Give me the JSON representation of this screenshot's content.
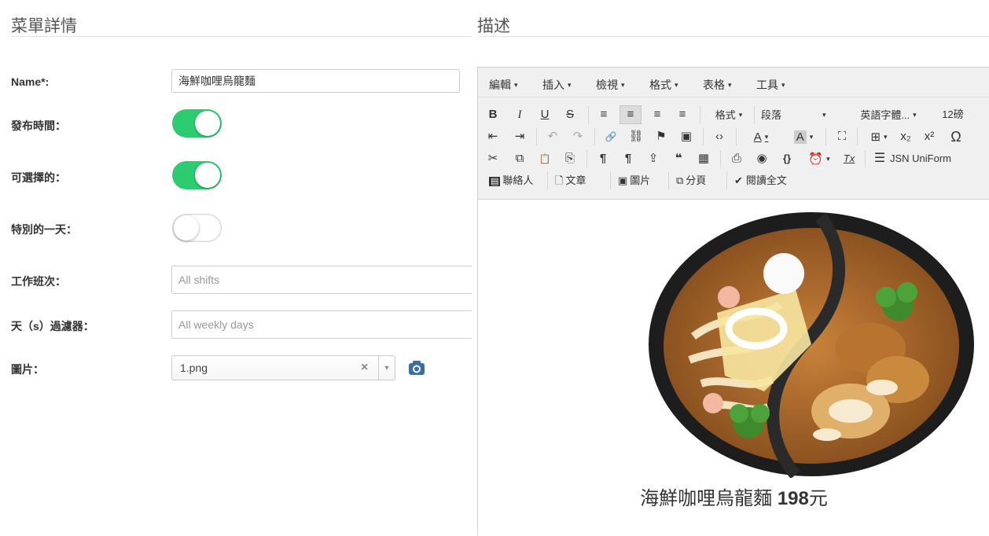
{
  "left_panel": {
    "title": "菜單詳情",
    "name_label": "Name*:",
    "name_value": "海鮮咖哩烏龍麵",
    "publish_label": "發布時間：",
    "publish_on": true,
    "selectable_label": "可選擇的：",
    "selectable_on": true,
    "special_day_label": "特別的一天：",
    "special_day_on": false,
    "shift_label": "工作班次：",
    "shift_placeholder": "All shifts",
    "days_filter_label": "天（s）過濾器：",
    "days_filter_placeholder": "All weekly days",
    "image_label": "圖片：",
    "image_value": "1.png",
    "image_clear": "×",
    "image_caret": "▾"
  },
  "right_panel": {
    "title": "描述"
  },
  "editor": {
    "menu": [
      "編輯",
      "插入",
      "檢視",
      "格式",
      "表格",
      "工具"
    ],
    "menu_caret": "▾",
    "row1": {
      "bold": "B",
      "italic": "I",
      "underline": "U",
      "strike": "S",
      "align_left": "≡",
      "align_center": "≡",
      "align_right": "≡",
      "justify": "≡",
      "formats": "格式",
      "paragraph": "段落",
      "font_family": "英語字體...",
      "font_size": "12磅"
    },
    "row2": {
      "outdent": "⇤",
      "indent": "⇥",
      "undo": "↶",
      "redo": "↷",
      "link": "🔗",
      "unlink": "⛓",
      "anchor": "⚑",
      "image": "▣",
      "code": "‹›",
      "text_color": "A",
      "bg_color": "A",
      "fullscreen": "⛶",
      "table": "⊞",
      "subscript": "x₂",
      "superscript": "x²",
      "omega": "Ω"
    },
    "row3": {
      "cut": "✂",
      "copy": "⧉",
      "paste": "📋",
      "paste_text": "⎘",
      "pilcrow": "¶",
      "pilcrow_rtl": "¶",
      "upload": "⇪",
      "quote": "❝",
      "template": "▦",
      "print": "⎙",
      "preview": "◉",
      "variable": "{}",
      "time": "⏰",
      "clear_format": "Tx",
      "jsn_uniform": "JSN UniForm"
    },
    "row4": {
      "contact": "聯絡人",
      "article": "文章",
      "image": "圖片",
      "pagebreak": "分頁",
      "readmore": "閱讀全文"
    },
    "content": {
      "caption_name": "海鮮咖哩烏龍麵",
      "caption_price": "198",
      "caption_unit": "元"
    }
  },
  "colors": {
    "toggle_on": "#2ecc71",
    "camera_icon": "#3a6ea5"
  }
}
